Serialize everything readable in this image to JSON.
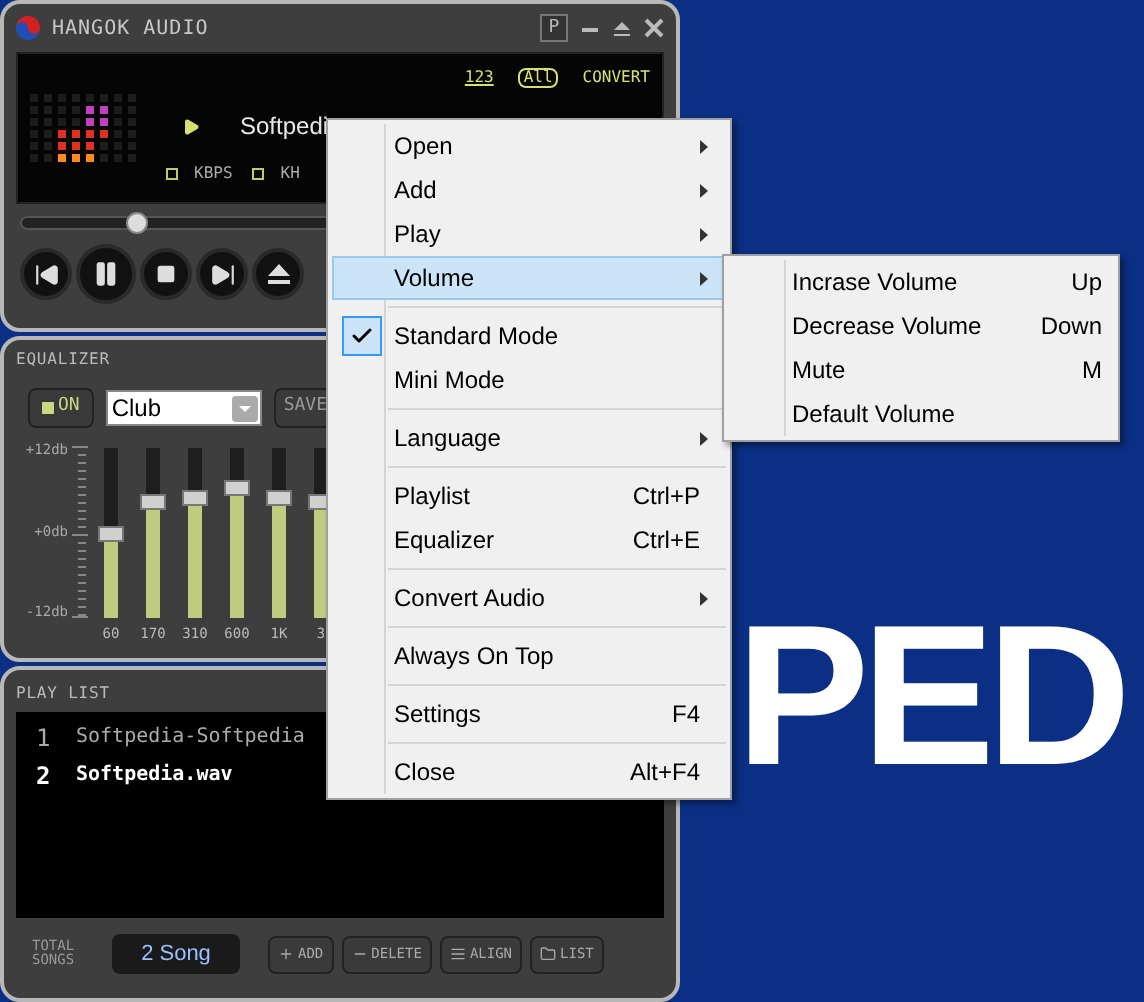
{
  "wallpaper": {
    "text": "PED"
  },
  "player": {
    "title": "HANGOK AUDIO",
    "pin_label": "P",
    "modes": [
      {
        "kind": "repeat-count",
        "label": "123"
      },
      {
        "kind": "repeat-all",
        "label": "All"
      },
      {
        "kind": "convert",
        "label": "CONVERT"
      }
    ],
    "track": "Softpedi",
    "info": [
      "KBPS",
      "KH"
    ],
    "seek": {
      "level": 0.18
    },
    "playing": true
  },
  "equalizer": {
    "title": "EQUALIZER",
    "power": {
      "label": "ON",
      "on": true
    },
    "preset": {
      "value": "Club"
    },
    "save_label": "SAVE",
    "scale": [
      "+12db",
      "+0db",
      "-12db"
    ],
    "bands": [
      {
        "label": "60",
        "level": 0.5
      },
      {
        "label": "170",
        "level": 0.68
      },
      {
        "label": "310",
        "level": 0.71
      },
      {
        "label": "600",
        "level": 0.76
      },
      {
        "label": "1K",
        "level": 0.71
      },
      {
        "label": "3",
        "level": 0.68
      }
    ]
  },
  "playlist": {
    "title": "PLAY LIST",
    "tracks": [
      {
        "number": "1",
        "name": "Softpedia-Softpedia",
        "selected": false
      },
      {
        "number": "2",
        "name": "Softpedia.wav",
        "selected": true
      }
    ],
    "total_label": "TOTAL SONGS",
    "total": "2 Song",
    "buttons": [
      {
        "kind": "add",
        "label": "ADD"
      },
      {
        "kind": "delete",
        "label": "DELETE"
      },
      {
        "kind": "align",
        "label": "ALIGN"
      },
      {
        "kind": "list",
        "label": "LIST"
      }
    ]
  },
  "context_menu": {
    "items": [
      {
        "kind": "item",
        "label": "Open",
        "submenu": true,
        "selected": false,
        "checked": false
      },
      {
        "kind": "item",
        "label": "Add",
        "submenu": true,
        "selected": false,
        "checked": false
      },
      {
        "kind": "item",
        "label": "Play",
        "submenu": true,
        "selected": false,
        "checked": false
      },
      {
        "kind": "item",
        "label": "Volume",
        "submenu": true,
        "selected": true,
        "checked": false
      },
      {
        "kind": "separator"
      },
      {
        "kind": "item",
        "label": "Standard Mode",
        "submenu": false,
        "selected": false,
        "checked": true
      },
      {
        "kind": "item",
        "label": "Mini Mode",
        "submenu": false,
        "selected": false,
        "checked": false
      },
      {
        "kind": "separator"
      },
      {
        "kind": "item",
        "label": "Language",
        "submenu": true,
        "selected": false,
        "checked": false
      },
      {
        "kind": "separator"
      },
      {
        "kind": "item",
        "label": "Playlist",
        "shortcut": "Ctrl+P",
        "submenu": false,
        "selected": false,
        "checked": false
      },
      {
        "kind": "item",
        "label": "Equalizer",
        "shortcut": "Ctrl+E",
        "submenu": false,
        "selected": false,
        "checked": false
      },
      {
        "kind": "separator"
      },
      {
        "kind": "item",
        "label": "Convert Audio",
        "submenu": true,
        "selected": false,
        "checked": false
      },
      {
        "kind": "separator"
      },
      {
        "kind": "item",
        "label": "Always On Top",
        "submenu": false,
        "selected": false,
        "checked": false
      },
      {
        "kind": "separator"
      },
      {
        "kind": "item",
        "label": "Settings",
        "shortcut": "F4",
        "submenu": false,
        "selected": false,
        "checked": false
      },
      {
        "kind": "separator"
      },
      {
        "kind": "item",
        "label": "Close",
        "shortcut": "Alt+F4",
        "submenu": false,
        "selected": false,
        "checked": false
      }
    ]
  },
  "volume_submenu": {
    "items": [
      {
        "label": "Incrase Volume",
        "shortcut": "Up"
      },
      {
        "label": "Decrease Volume",
        "shortcut": "Down"
      },
      {
        "label": "Mute",
        "shortcut": "M"
      },
      {
        "label": "Default Volume"
      }
    ]
  }
}
